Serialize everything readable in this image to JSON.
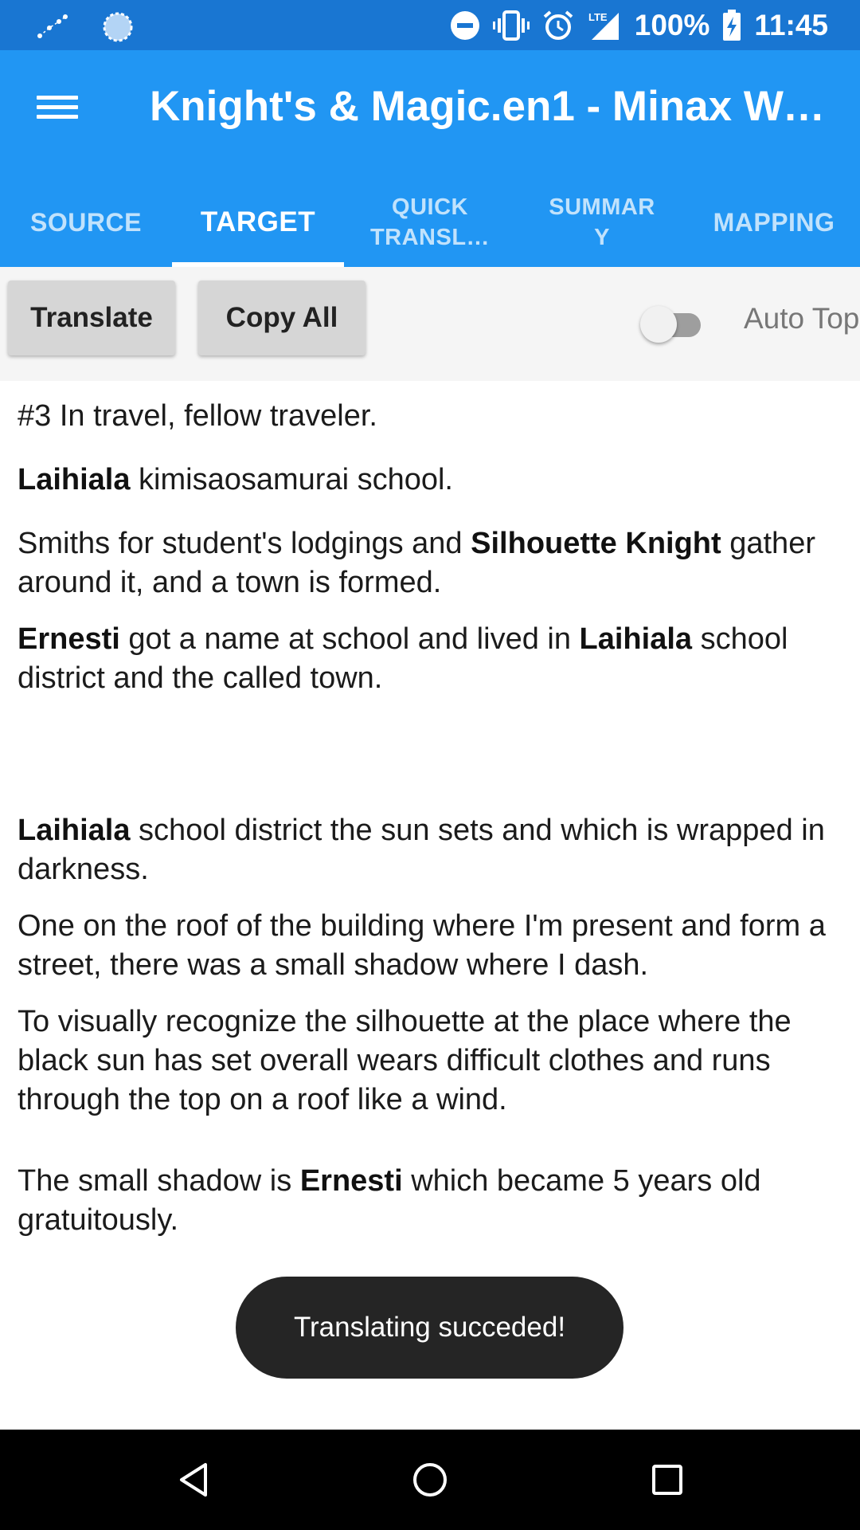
{
  "status_bar": {
    "battery": "100%",
    "time": "11:45",
    "network": "LTE",
    "icons": [
      "constellation-icon",
      "circle-loader-icon",
      "do-not-disturb-icon",
      "vibrate-icon",
      "alarm-icon",
      "signal-icon",
      "battery-charging-icon"
    ]
  },
  "app_bar": {
    "title": "Knight's & Magic.en1 - Minax Web…",
    "menu_icon": "hamburger-menu-icon"
  },
  "tabs": [
    {
      "label": "SOURCE",
      "active": false
    },
    {
      "label": "TARGET",
      "active": true
    },
    {
      "label": "QUICK TRANSL…",
      "active": false
    },
    {
      "label": "SUMMAR Y",
      "active": false
    },
    {
      "label": "MAPPING",
      "active": false
    }
  ],
  "toolbar": {
    "translate_label": "Translate",
    "copy_all_label": "Copy All",
    "auto_top_label": "Auto Top",
    "auto_top_on": false
  },
  "content": {
    "p1": "#3 In travel, fellow traveler.",
    "p2_bold": "Laihiala",
    "p2_rest": " kimisaosamurai school.",
    "p3_a": "Smiths for student's lodgings and ",
    "p3_bold": "Silhouette Knight",
    "p3_b": " gather around it, and a town is formed.",
    "p4_bold1": "Ernesti",
    "p4_a": " got a name at school and lived in ",
    "p4_bold2": "Laihiala",
    "p4_b": " school district and the called town.",
    "p5_bold": "Laihiala",
    "p5_rest": " school district the sun sets and which is wrapped in darkness.",
    "p6": "One on the roof of the building where I'm present and form a street, there was a small shadow where I dash.",
    "p7": "To visually recognize the silhouette at the place where the black sun has set overall wears difficult clothes and runs through the top on a roof like a wind.",
    "p8_a": "The small shadow is ",
    "p8_bold": "Ernesti",
    "p8_b": " which became 5 years old gratuitously."
  },
  "toast": {
    "message": "Translating succeded!"
  },
  "nav_bar": {
    "icons": [
      "back-icon",
      "home-icon",
      "recents-icon"
    ]
  },
  "colors": {
    "status_bar": "#1976d2",
    "app_bar": "#2196f3",
    "toast_bg": "#141414"
  }
}
